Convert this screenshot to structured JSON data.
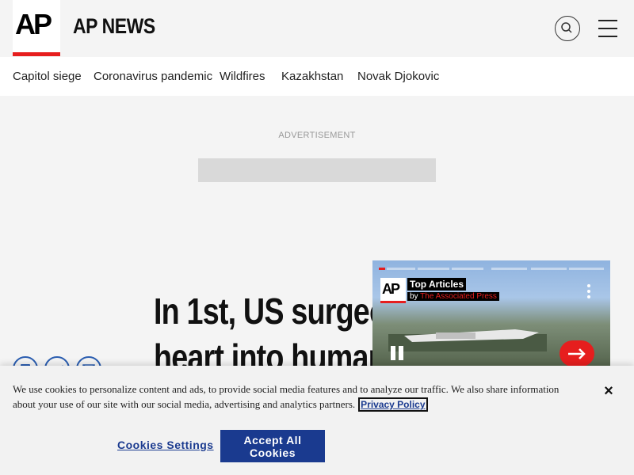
{
  "header": {
    "logo_text": "AP",
    "site_name": "AP NEWS"
  },
  "nav": {
    "items": [
      "Capitol siege",
      "Coronavirus pandemic",
      "Wildfires",
      "Kazakhstan",
      "Novak Djokovic"
    ]
  },
  "ad": {
    "label": "ADVERTISEMENT"
  },
  "article": {
    "headline_lines": [
      "In 1st, US surgeon",
      "heart into human"
    ]
  },
  "video": {
    "logo_text": "AP",
    "title": "Top Articles",
    "by_prefix": "by ",
    "by_source": "The Associated Press"
  },
  "cookie": {
    "text": "We use cookies to personalize content and ads, to provide social media features and to analyze our traffic. We also share information about your use of our site with our social media, advertising and analytics partners.",
    "link": "Privacy Policy",
    "close": "×",
    "settings": "Cookies Settings",
    "accept": "Accept All Cookies"
  },
  "colors": {
    "brand_red": "#e61e1e",
    "link_blue": "#1a3a8f",
    "share_blue": "#2a5db0"
  },
  "icons": [
    "search-icon",
    "menu-icon",
    "facebook-icon",
    "twitter-icon",
    "email-icon",
    "more-icon",
    "pause-icon",
    "arrow-right-icon",
    "close-icon"
  ]
}
